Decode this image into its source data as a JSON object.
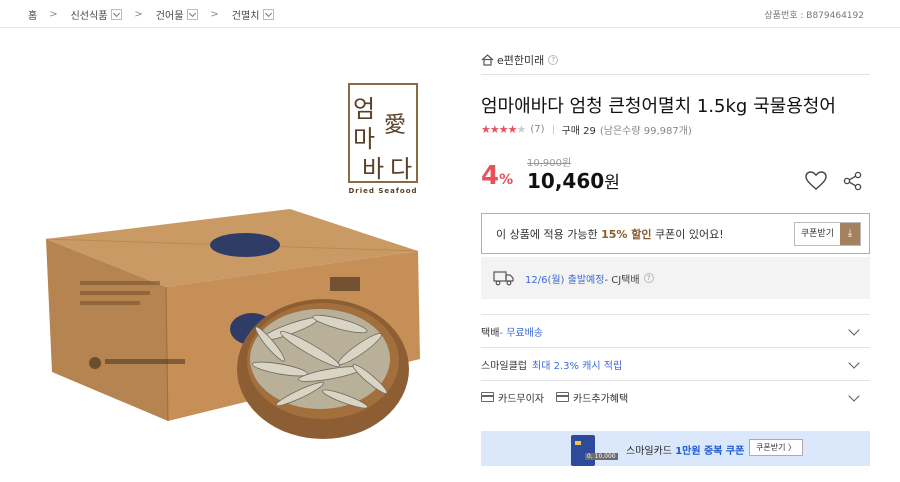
{
  "breadcrumb": {
    "items": [
      "홈",
      "신선식품",
      "건어물",
      "건멸치"
    ],
    "product_no": "상품번호 : B879464192"
  },
  "product_image": {
    "brand_chars": [
      "엄",
      "마",
      "愛",
      "바",
      "다"
    ],
    "brand_sub": "Dried Seafood"
  },
  "seller": {
    "name": "e편한미래",
    "help": "?"
  },
  "product": {
    "title": "엄마애바다 엄청 큰청어멸치 1.5kg 국물용청어",
    "rating": 4,
    "rating_max": 5,
    "review_count": "(7)",
    "sold": "구매 29",
    "stock": "(남은수량 99,987개)",
    "original_price": "10,900원",
    "discount_num": "4",
    "discount_unit": "%",
    "price_num": "10,460",
    "price_unit": "원"
  },
  "coupon": {
    "text_pre": "이 상품에 적용 가능한 ",
    "text_hl": "15% 할인",
    "text_post": " 쿠폰이 있어요!",
    "button": "쿠폰받기",
    "button_icon": "download-icon"
  },
  "shipping": {
    "date": "12/6(월) 출발예정",
    "carrier": " - CJ택배",
    "help": "?"
  },
  "options": {
    "delivery_label": "택배",
    "delivery_value": " - 무료배송",
    "smileclub_label": "스마일클럽",
    "smileclub_value": "최대 2.3% 캐시 적립",
    "card_free": "카드무이자",
    "card_extra": "카드추가혜택"
  },
  "banner": {
    "card_note": "0, 10,000",
    "text_pre": "스마일카드 ",
    "text_hl": "1만원 중복 쿠폰",
    "button": "쿠폰받기 〉"
  },
  "colors": {
    "accent_red": "#e8505b",
    "link_blue": "#3f6ad8",
    "coupon_brown": "#a4815e"
  }
}
